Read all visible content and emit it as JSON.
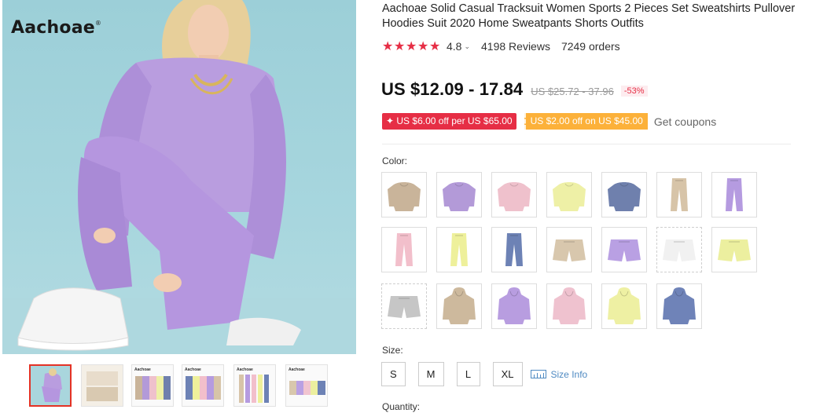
{
  "gallery": {
    "brand": "Aachoae",
    "brand_mark": "®",
    "thumbnails": [
      {
        "name": "thumb-1",
        "active": true,
        "logo": ""
      },
      {
        "name": "thumb-2",
        "active": false,
        "logo": ""
      },
      {
        "name": "thumb-3",
        "active": false,
        "logo": "Aachoae"
      },
      {
        "name": "thumb-4",
        "active": false,
        "logo": "Aachoae"
      },
      {
        "name": "thumb-5",
        "active": false,
        "logo": "Aachoae"
      },
      {
        "name": "thumb-6",
        "active": false,
        "logo": "Aachoae"
      }
    ]
  },
  "product": {
    "title": "Aachoae Solid Casual Tracksuit Women Sports 2 Pieces Set Sweatshirts Pullover Hoodies Suit 2020 Home Sweatpants Shorts Outfits",
    "rating": "4.8",
    "reviews": "4198 Reviews",
    "orders": "7249 orders",
    "price": "US $12.09 - 17.84",
    "original_price": "US $25.72 - 37.96",
    "discount": "-53%",
    "coupon_red": "✦ US $6.00 off per US $65.00",
    "coupon_orange": "US $2.00 off on US $45.00",
    "get_coupons": "Get coupons",
    "color_label": "Color:",
    "size_label": "Size:",
    "size_info": "Size Info",
    "quantity_label": "Quantity:",
    "sizes": [
      "S",
      "M",
      "L",
      "XL"
    ]
  },
  "swatches": [
    {
      "kind": "sweatshirt",
      "color": "#c9b49a"
    },
    {
      "kind": "sweatshirt",
      "color": "#b39ad8"
    },
    {
      "kind": "sweatshirt",
      "color": "#efc1cc"
    },
    {
      "kind": "sweatshirt",
      "color": "#eef0a6"
    },
    {
      "kind": "sweatshirt",
      "color": "#6f80ad"
    },
    {
      "kind": "pants",
      "color": "#d7c4a8"
    },
    {
      "kind": "pants",
      "color": "#b59be0"
    },
    {
      "kind": "pants",
      "color": "#f2bfcb"
    },
    {
      "kind": "pants",
      "color": "#eef09b"
    },
    {
      "kind": "pants",
      "color": "#6d82b5"
    },
    {
      "kind": "shorts",
      "color": "#d8c7ad"
    },
    {
      "kind": "shorts",
      "color": "#b9a0e3"
    },
    {
      "kind": "shorts",
      "color": "#f1f1f1",
      "dashed": true
    },
    {
      "kind": "shorts",
      "color": "#ecef9f"
    },
    {
      "kind": "shorts",
      "color": "#c6c6c6",
      "dashed": true
    },
    {
      "kind": "hoodie",
      "color": "#cdb99d"
    },
    {
      "kind": "hoodie",
      "color": "#b89de0"
    },
    {
      "kind": "hoodie",
      "color": "#efc2cf"
    },
    {
      "kind": "hoodie",
      "color": "#eef0a3"
    },
    {
      "kind": "hoodie",
      "color": "#6f83b8"
    }
  ]
}
